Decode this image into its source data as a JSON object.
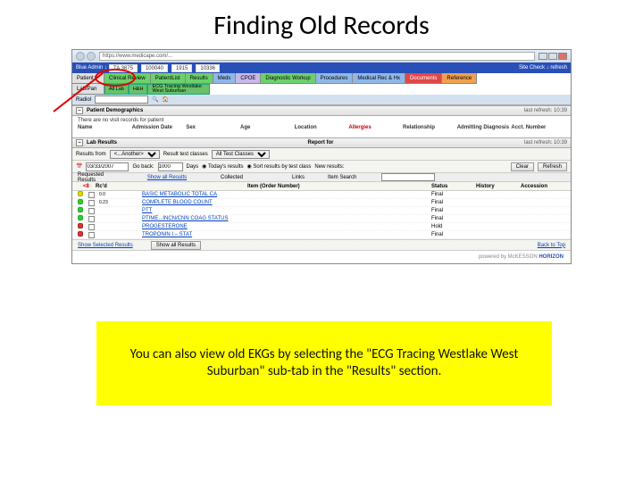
{
  "title": "Finding Old Records",
  "browser": {
    "url": "https://www.medicape.com/..."
  },
  "header": {
    "label_pt": "Blue Admin ↓",
    "fields": [
      "TA 3875",
      "100040",
      "1915",
      "10336"
    ],
    "right": "Site Check ↓   refresh"
  },
  "main_tabs": [
    {
      "label": "Clinical Review",
      "cls": "t-green"
    },
    {
      "label": "PatientList",
      "cls": "t-green"
    },
    {
      "label": "Results",
      "cls": "t-green"
    },
    {
      "label": "Meds",
      "cls": "t-blue"
    },
    {
      "label": "CPOE",
      "cls": "t-lav"
    },
    {
      "label": "Diagnostic Workup",
      "cls": "t-green"
    },
    {
      "label": "Procedures",
      "cls": "t-blue"
    },
    {
      "label": "Medical Rec & Hx",
      "cls": "t-blue"
    },
    {
      "label": "Documents",
      "cls": "t-red"
    },
    {
      "label": "Reference",
      "cls": "t-orange"
    }
  ],
  "sub_tabs": [
    {
      "label": "All Lab"
    },
    {
      "label": "H&H"
    },
    {
      "label": "ECG Tracing Westlake West Suburban"
    }
  ],
  "left_labels": {
    "patient": "Patient",
    "lab": "Lab/Pan",
    "radio": "Radiol"
  },
  "demo": {
    "title": "Patient Demographics",
    "msg": "There are no visit records for patient",
    "refresh": "last refresh: 10:39",
    "cols": [
      "Name",
      "Admission Date",
      "Sex",
      "Age",
      "Location",
      "Allergies",
      "Relationship",
      "Admitting Diagnosis",
      "Acct. Number"
    ]
  },
  "lab": {
    "title": "Lab Results",
    "report_for": "Report for",
    "refresh": "last refresh: 10:39",
    "filter": {
      "from_lbl": "Results from",
      "from_sel": "<...Another>",
      "class_lbl": "Result test classes",
      "class_sel": "All Test Classes",
      "date": "03/33/2007",
      "back_lbl": "Go back:",
      "back_val": "1000",
      "days": "Days",
      "today": "Today's results",
      "sort": "Sort results by test class",
      "new": "New results:",
      "clear": "Clear",
      "refresh_btn": "Refresh"
    },
    "subheader": {
      "req": "Requested Results",
      "show": "Show all Results",
      "collected": "Collected",
      "links": "Links",
      "item_search": "Item Search",
      "item": "Item (Order Number)",
      "status": "Status",
      "history": "History",
      "accession": "Accession"
    },
    "redlabel": "<8",
    "rows": [
      {
        "icon": "dot-y",
        "cb": "",
        "num": "0.0",
        "item": "BASIC METABOLIC TOTAL CA",
        "status": "Final"
      },
      {
        "icon": "dot-g",
        "cb": "",
        "num": "0.23",
        "item": "COMPLETE BLOOD COUNT",
        "status": "Final"
      },
      {
        "icon": "dot-g",
        "cb": "",
        "num": "",
        "item": "PTT",
        "status": "Final"
      },
      {
        "icon": "dot-g",
        "cb": "",
        "num": "",
        "item": "PTIME...INCN/CNN COAG STATUS",
        "status": "Final"
      },
      {
        "icon": "dot-r",
        "cb": "",
        "num": "",
        "item": "PROGESTERONE",
        "status": "Hold"
      },
      {
        "icon": "dot-r",
        "cb": "",
        "num": "",
        "item": "TROPONIN I – STAT",
        "status": "Final"
      }
    ],
    "footer": {
      "show_sel": "Show Selected Results",
      "show_all": "Show all Results"
    }
  },
  "logo": {
    "powered": "powered by",
    "brand": "HORIZON",
    "co": "McKESSON"
  },
  "callout": "You can also view old EKGs by selecting the \"ECG Tracing Westlake West Suburban\" sub-tab in the \"Results\" section."
}
